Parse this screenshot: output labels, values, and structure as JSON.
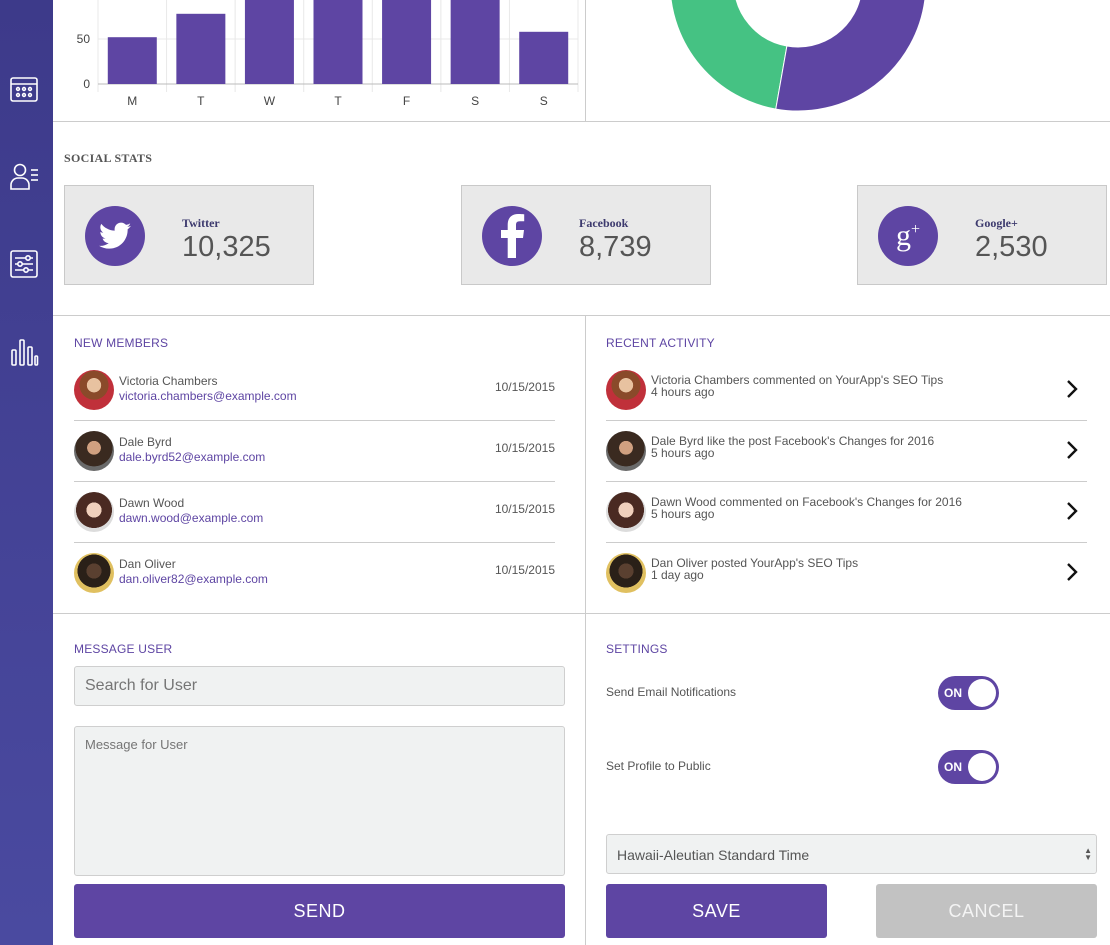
{
  "chart_data": [
    {
      "type": "bar",
      "categories": [
        "M",
        "T",
        "W",
        "T",
        "F",
        "S",
        "S"
      ],
      "values": [
        52,
        78,
        110,
        110,
        110,
        110,
        58
      ],
      "yticks": [
        "0",
        "50"
      ],
      "ylim": [
        0,
        110
      ],
      "color": "#5e45a3",
      "grid": true
    },
    {
      "type": "pie",
      "donut": true,
      "values": [
        22,
        78
      ],
      "colors": [
        "#45c283",
        "#5e45a3"
      ]
    }
  ],
  "sidebar": {
    "icons": [
      "calendar-icon",
      "user-list-icon",
      "sliders-icon",
      "bar-chart-icon"
    ]
  },
  "social": {
    "title": "SOCIAL STATS",
    "cards": [
      {
        "name": "Twitter",
        "value": "10,325",
        "icon": "twitter-icon"
      },
      {
        "name": "Facebook",
        "value": "8,739",
        "icon": "facebook-icon"
      },
      {
        "name": "Google+",
        "value": "2,530",
        "icon": "google-plus-icon"
      }
    ]
  },
  "members": {
    "title": "NEW MEMBERS",
    "rows": [
      {
        "name": "Victoria Chambers",
        "email": "victoria.chambers@example.com",
        "date": "10/15/2015"
      },
      {
        "name": "Dale Byrd",
        "email": "dale.byrd52@example.com",
        "date": "10/15/2015"
      },
      {
        "name": "Dawn Wood",
        "email": "dawn.wood@example.com",
        "date": "10/15/2015"
      },
      {
        "name": "Dan Oliver",
        "email": "dan.oliver82@example.com",
        "date": "10/15/2015"
      }
    ]
  },
  "activity": {
    "title": "RECENT ACTIVITY",
    "rows": [
      {
        "text": "Victoria Chambers commented on YourApp's SEO Tips",
        "time": "4 hours ago"
      },
      {
        "text": "Dale Byrd like the post Facebook's Changes for 2016",
        "time": "5 hours ago"
      },
      {
        "text": "Dawn Wood commented on Facebook's Changes for 2016",
        "time": "5 hours ago"
      },
      {
        "text": "Dan Oliver posted YourApp's SEO Tips",
        "time": "1 day ago"
      }
    ]
  },
  "message": {
    "title": "MESSAGE USER",
    "search_placeholder": "Search for User",
    "message_placeholder": "Message for User",
    "send_label": "SEND"
  },
  "settings": {
    "title": "SETTINGS",
    "email_label": "Send Email Notifications",
    "email_toggle": "ON",
    "public_label": "Set Profile to Public",
    "public_toggle": "ON",
    "timezone": "Hawaii-Aleutian Standard Time",
    "save_label": "SAVE",
    "cancel_label": "CANCEL"
  }
}
